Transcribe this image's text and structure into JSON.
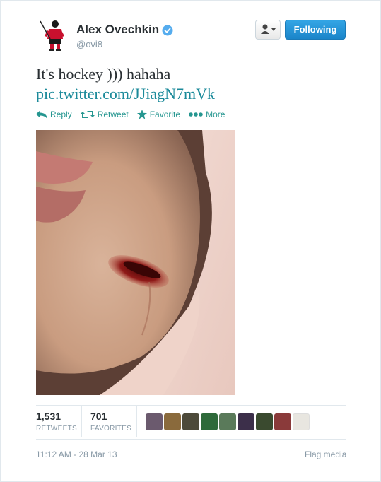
{
  "header": {
    "name": "Alex Ovechkin",
    "handle": "@ovi8",
    "follow_label": "Following"
  },
  "tweet": {
    "text": "It's hockey ))) hahaha",
    "link": "pic.twitter.com/JJiagN7mVk"
  },
  "actions": {
    "reply": "Reply",
    "retweet": "Retweet",
    "favorite": "Favorite",
    "more": "More"
  },
  "stats": {
    "retweets_count": "1,531",
    "retweets_label": "RETWEETS",
    "favorites_count": "701",
    "favorites_label": "FAVORITES"
  },
  "footer": {
    "timestamp": "11:12 AM - 28 Mar 13",
    "flag_label": "Flag media"
  },
  "colors": {
    "follow_button": "#2b9ad8",
    "link": "#1b8a9a",
    "verified": "#55acee"
  }
}
